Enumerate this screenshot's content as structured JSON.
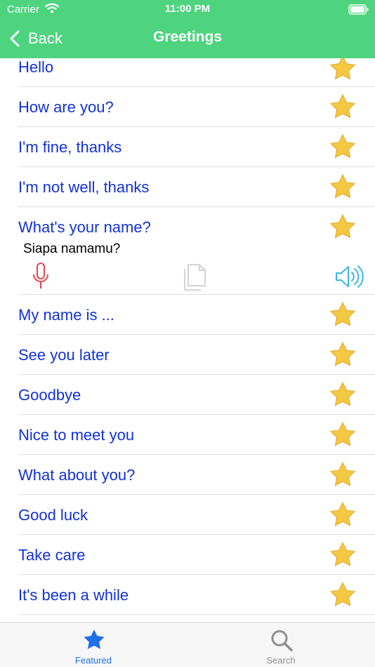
{
  "status_bar": {
    "carrier": "Carrier",
    "time": "11:00 PM"
  },
  "nav": {
    "back_label": "Back",
    "title": "Greetings"
  },
  "phrases": [
    {
      "text": "Hello"
    },
    {
      "text": "How are you?"
    },
    {
      "text": "I'm fine, thanks"
    },
    {
      "text": "I'm not well, thanks"
    },
    {
      "text": "What's your name?",
      "expanded": true,
      "translation": "Siapa namamu?"
    },
    {
      "text": "My name is ..."
    },
    {
      "text": "See you later"
    },
    {
      "text": "Goodbye"
    },
    {
      "text": "Nice to meet you"
    },
    {
      "text": "What about you?"
    },
    {
      "text": "Good luck"
    },
    {
      "text": "Take care"
    },
    {
      "text": "It's been a while"
    }
  ],
  "tabs": [
    {
      "label": "Featured",
      "icon": "star-icon",
      "selected": true
    },
    {
      "label": "Search",
      "icon": "search-icon",
      "selected": false
    }
  ],
  "colors": {
    "header": "#4ED47F",
    "phrase_text": "#1231D8",
    "star": "#F5C842",
    "mic": "#E8424B",
    "speaker": "#3BB8E0",
    "tab_selected": "#1E6FE8"
  }
}
